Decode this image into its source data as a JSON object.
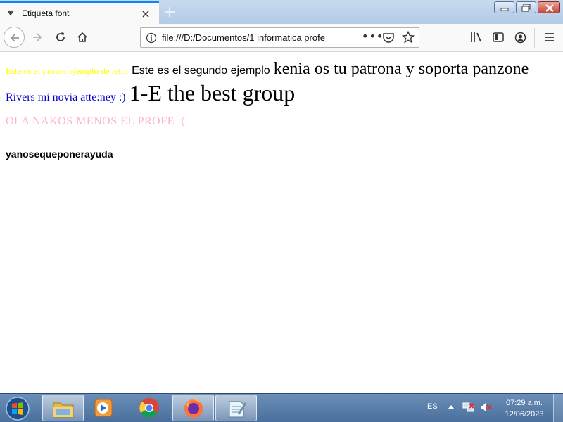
{
  "browser": {
    "tab_title": "Etiqueta font",
    "url": "file:///D:/Documentos/1 informatica profe",
    "url_more": "•••"
  },
  "page": {
    "line1": {
      "yellow": "Este es el primer ejemplo de letra",
      "sans": "Este es el segundo ejemplo",
      "big": "kenia os tu patrona y soporta panzone"
    },
    "line2": {
      "blue": "Rivers mi novia atte:ney :)",
      "huge": "1-E the best group"
    },
    "line3": "OLA NAKOS MENOS EL PROFE :(",
    "line4": "yanosequeponerayuda"
  },
  "colors": {
    "yellow_text": "#ffff00",
    "blue_text": "#0000cc",
    "pink_text": "#ffb6c6",
    "tab_accent": "#0a84ff"
  },
  "taskbar": {
    "language": "ES",
    "time": "07:29 a.m.",
    "date": "12/06/2023",
    "apps": [
      "windows-explorer",
      "media-player",
      "chrome",
      "firefox",
      "notepad"
    ]
  }
}
